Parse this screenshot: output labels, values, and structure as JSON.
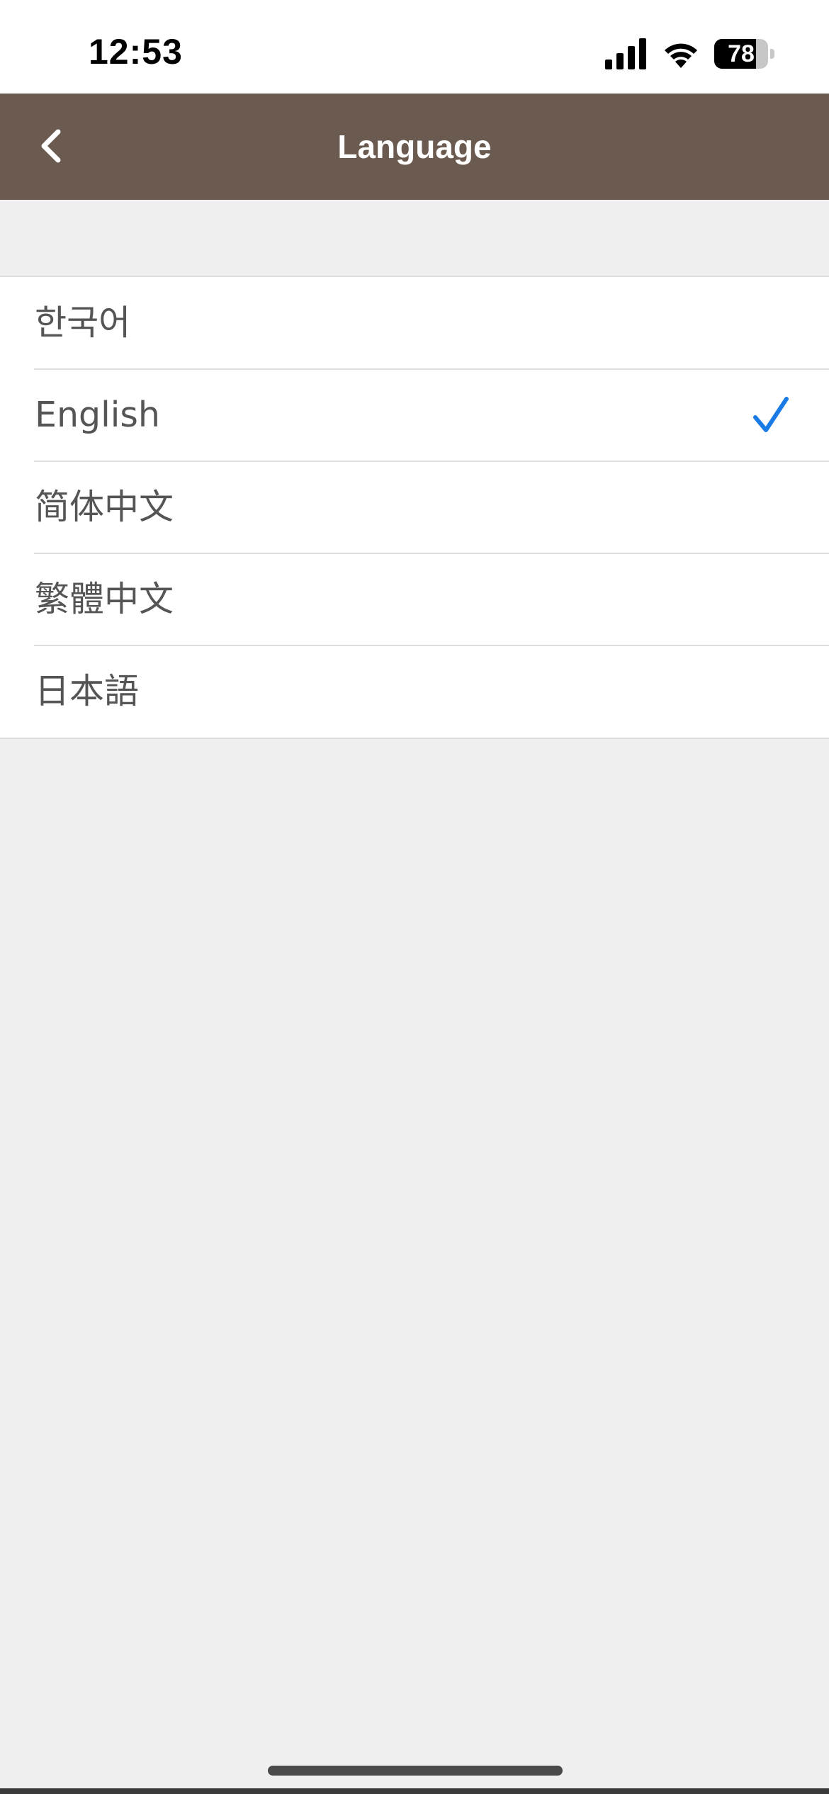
{
  "status_bar": {
    "time": "12:53",
    "battery_percent": "78",
    "battery_level": 0.78,
    "icons": [
      "signal-icon",
      "wifi-icon",
      "battery-icon"
    ]
  },
  "header": {
    "title": "Language",
    "back_icon": "chevron-left-icon",
    "background_color": "#6b5a4f"
  },
  "languages": {
    "items": [
      {
        "label": "한국어",
        "selected": false
      },
      {
        "label": "English",
        "selected": true
      },
      {
        "label": "简体中文",
        "selected": false
      },
      {
        "label": "繁體中文",
        "selected": false
      },
      {
        "label": "日本語",
        "selected": false
      }
    ],
    "check_color": "#1a7ae6"
  }
}
